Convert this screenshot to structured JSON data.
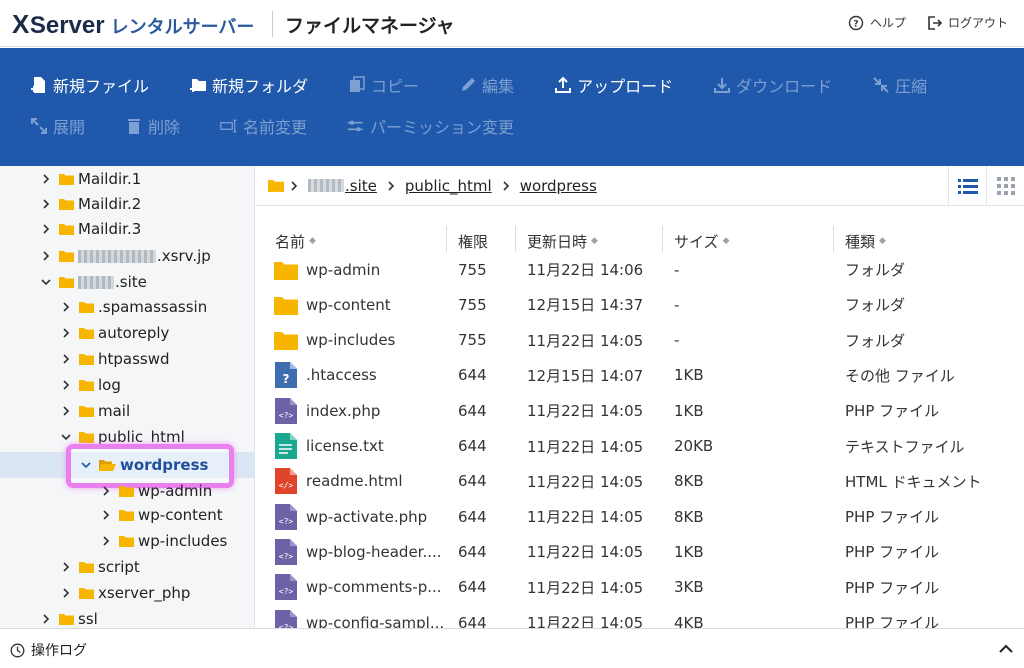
{
  "brand": {
    "x": "X",
    "server": "Server",
    "rental": "レンタルサーバー"
  },
  "app_title": "ファイルマネージャ",
  "top_links": {
    "help": "ヘルプ",
    "logout": "ログアウト"
  },
  "toolbar": {
    "new_file": "新規ファイル",
    "new_folder": "新規フォルダ",
    "copy": "コピー",
    "edit": "編集",
    "upload": "アップロード",
    "download": "ダウンロード",
    "compress": "圧縮",
    "extract": "展開",
    "delete": "削除",
    "rename": "名前変更",
    "permission": "パーミッション変更"
  },
  "tree": {
    "maildir1": "Maildir.1",
    "maildir2": "Maildir.2",
    "maildir3": "Maildir.3",
    "xsrv_suffix": ".xsrv.jp",
    "site_suffix": ".site",
    "spamassassin": ".spamassassin",
    "autoreply": "autoreply",
    "htpasswd": "htpasswd",
    "log": "log",
    "mail": "mail",
    "public_html": "public_html",
    "wordpress": "wordpress",
    "wp_admin": "wp-admin",
    "wp_content": "wp-content",
    "wp_includes": "wp-includes",
    "script": "script",
    "xserver_php": "xserver_php",
    "ssl": "ssl"
  },
  "breadcrumb": {
    "site_suffix": ".site",
    "public_html": "public_html",
    "wordpress": "wordpress"
  },
  "columns": {
    "name": "名前",
    "perm": "権限",
    "date": "更新日時",
    "size": "サイズ",
    "type": "種類"
  },
  "files": [
    {
      "name": "wp-admin",
      "perm": "755",
      "date": "11月22日 14:06",
      "size": "-",
      "type": "フォルダ",
      "icon": "folder"
    },
    {
      "name": "wp-content",
      "perm": "755",
      "date": "12月15日 14:37",
      "size": "-",
      "type": "フォルダ",
      "icon": "folder"
    },
    {
      "name": "wp-includes",
      "perm": "755",
      "date": "11月22日 14:05",
      "size": "-",
      "type": "フォルダ",
      "icon": "folder"
    },
    {
      "name": ".htaccess",
      "perm": "644",
      "date": "12月15日 14:07",
      "size": "1KB",
      "type": "その他 ファイル",
      "icon": "other"
    },
    {
      "name": "index.php",
      "perm": "644",
      "date": "11月22日 14:05",
      "size": "1KB",
      "type": "PHP ファイル",
      "icon": "php"
    },
    {
      "name": "license.txt",
      "perm": "644",
      "date": "11月22日 14:05",
      "size": "20KB",
      "type": "テキストファイル",
      "icon": "text"
    },
    {
      "name": "readme.html",
      "perm": "644",
      "date": "11月22日 14:05",
      "size": "8KB",
      "type": "HTML ドキュメント",
      "icon": "html"
    },
    {
      "name": "wp-activate.php",
      "perm": "644",
      "date": "11月22日 14:05",
      "size": "8KB",
      "type": "PHP ファイル",
      "icon": "php"
    },
    {
      "name": "wp-blog-header....",
      "perm": "644",
      "date": "11月22日 14:05",
      "size": "1KB",
      "type": "PHP ファイル",
      "icon": "php"
    },
    {
      "name": "wp-comments-p...",
      "perm": "644",
      "date": "11月22日 14:05",
      "size": "3KB",
      "type": "PHP ファイル",
      "icon": "php"
    },
    {
      "name": "wp-config-sampl...",
      "perm": "644",
      "date": "11月22日 14:05",
      "size": "4KB",
      "type": "PHP ファイル",
      "icon": "php"
    }
  ],
  "bottom": {
    "oplog": "操作ログ"
  },
  "colors": {
    "toolbar": "#2059ab",
    "folder": "#f7b500",
    "highlight": "#ea7ff0",
    "php_icon": "#6b63a6",
    "text_icon": "#1aa88f",
    "html_icon": "#e0452b",
    "other_icon": "#3d6fb0"
  }
}
